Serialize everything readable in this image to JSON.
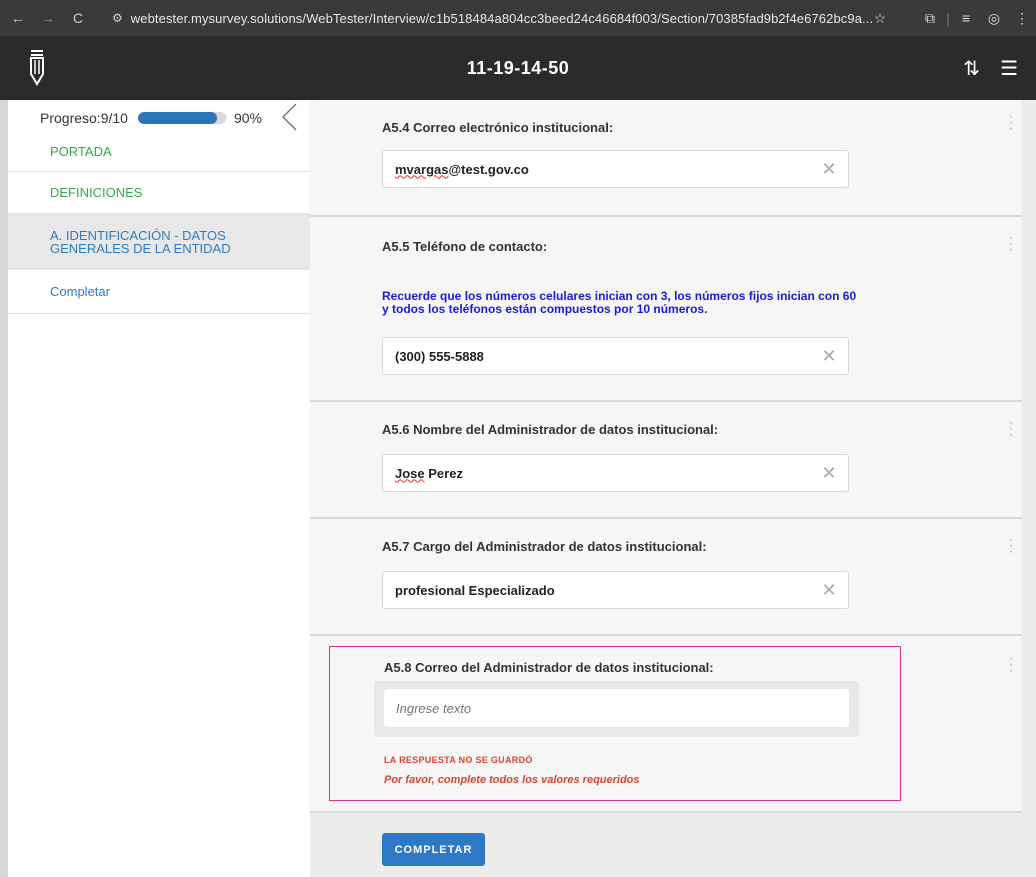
{
  "browser": {
    "url": "webtester.mysurvey.solutions/WebTester/Interview/c1b518484a804cc3beed24c46684f003/Section/70385fad9b2f4e6762bc9a...",
    "back_icon": "back-arrow-icon",
    "forward_icon": "forward-arrow-icon",
    "reload_icon": "reload-icon"
  },
  "header": {
    "title": "11-19-14-50"
  },
  "sidebar": {
    "progress_label": "Progreso:9/10",
    "progress_percent": "90%",
    "progress_value": 0.9,
    "items": [
      {
        "label": "PORTADA",
        "state": "complete"
      },
      {
        "label": "DEFINICIONES",
        "state": "complete"
      },
      {
        "label": "A. IDENTIFICACIÓN - DATOS GENERALES DE LA ENTIDAD",
        "state": "active"
      },
      {
        "label": "Completar",
        "state": "link"
      }
    ]
  },
  "questions": [
    {
      "label": "A5.4 Correo electrónico institucional:",
      "value_squiggle": "mvargas",
      "value_rest": "@test.gov.co"
    },
    {
      "label": "A5.5 Teléfono de contacto:",
      "hint_line1": "Recuerde que los números celulares inician con 3, los números fijos inician con 60",
      "hint_line2": "y todos los teléfonos están compuestos por 10 números.",
      "value": "(300) 555-5888"
    },
    {
      "label": "A5.6 Nombre del Administrador de datos institucional:",
      "value_squiggle": "Jose",
      "value_rest": " Perez"
    },
    {
      "label": "A5.7 Cargo del Administrador de datos institucional:",
      "value": "profesional Especializado"
    },
    {
      "label": "A5.8 Correo del Administrador de datos institucional:",
      "placeholder": "Ingrese texto",
      "error_small": "LA RESPUESTA NO SE GUARDÓ",
      "error_msg": "Por favor, complete todos los valores requeridos"
    }
  ],
  "complete_button": "COMPLETAR",
  "colors": {
    "accent": "#2e78c8",
    "success": "#3aa64a",
    "error": "#d9442b",
    "error_border": "#d6338a",
    "hint": "#1a1ad8"
  }
}
